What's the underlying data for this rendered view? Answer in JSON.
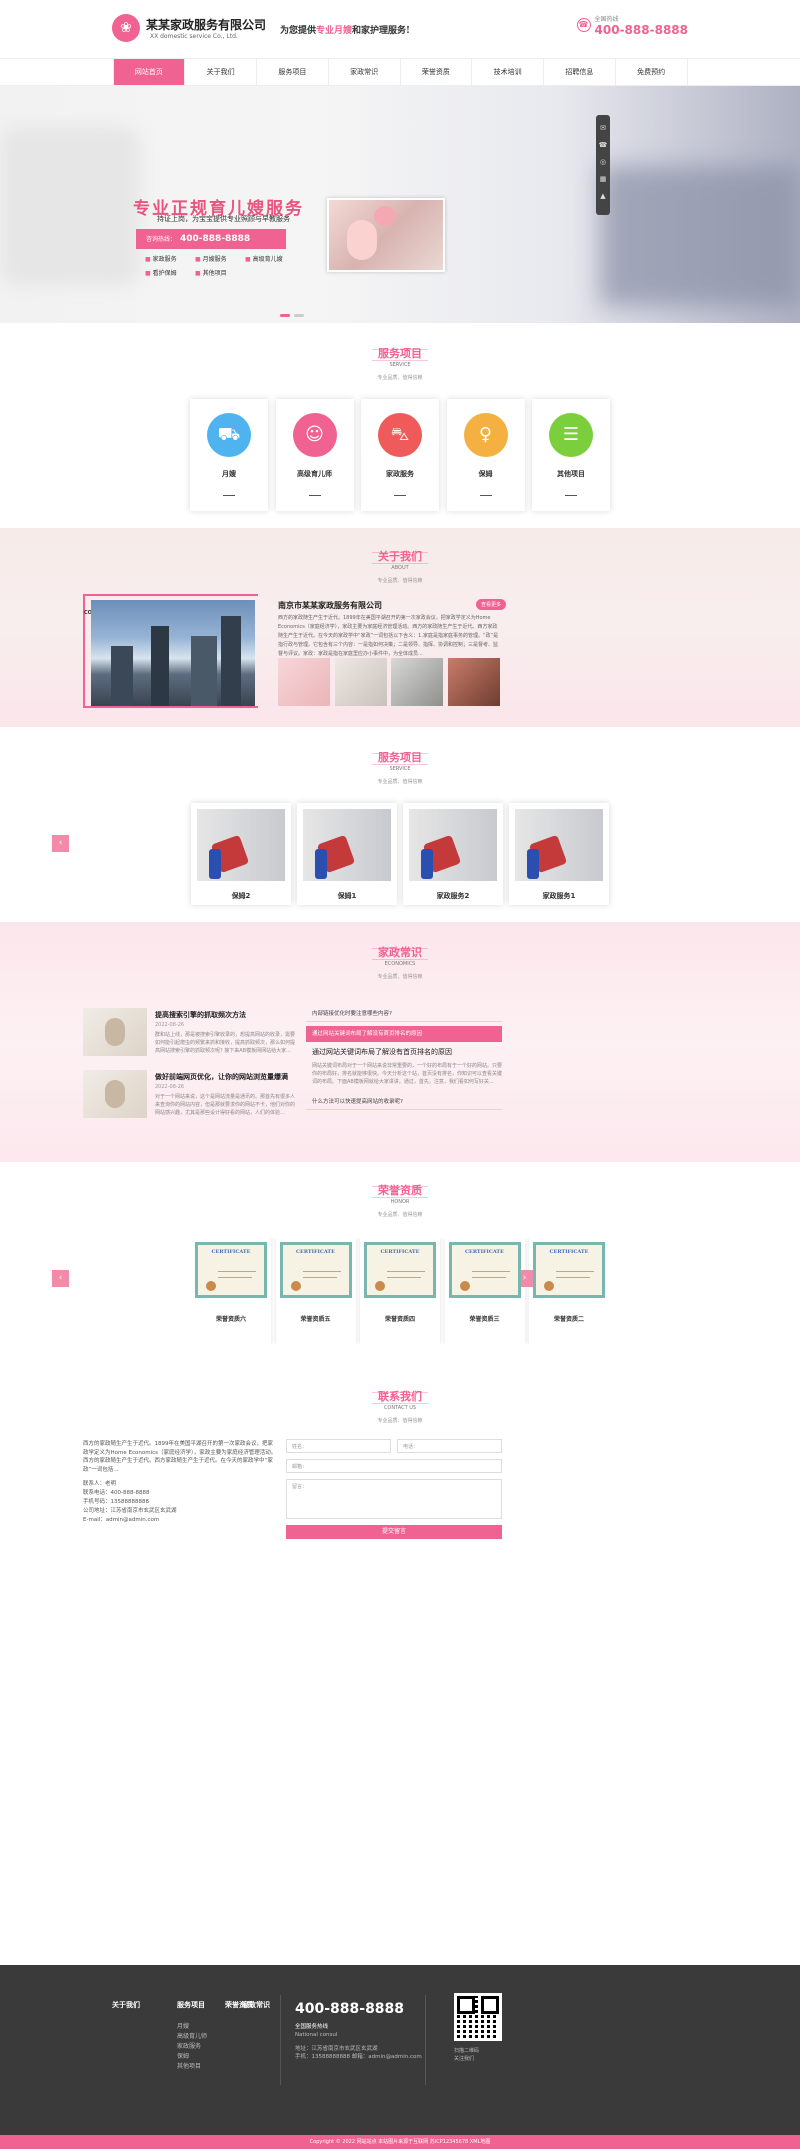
{
  "header": {
    "logo_icon": "flower-logo",
    "title": "某某家政服务有限公司",
    "subtitle": "XX domestic service Co., Ltd.",
    "slogan_pre": "为您提供",
    "slogan_hl": "专业月嫂",
    "slogan_post": "和家护理服务!",
    "hotline_label": "全国热线",
    "hotline": "400-888-8888"
  },
  "nav": [
    "网站首页",
    "关于我们",
    "服务项目",
    "家政常识",
    "荣誉资质",
    "技术培训",
    "招聘信息",
    "免费预约"
  ],
  "banner": {
    "title": "专业正规育儿嫂服务",
    "sub": "持证上岗，为宝宝提供专业照顾与早教服务",
    "phone_label": "咨询热线：",
    "phone": "400-888-8888",
    "tags": [
      "家政服务",
      "月嫂服务",
      "高级育儿嫂",
      "看护保姆",
      "其他项目"
    ]
  },
  "services": {
    "title": "服务项目",
    "en": "SERVICE",
    "desc": "专业品质、值得信赖",
    "items": [
      {
        "name": "月嫂",
        "icon": "stroller-icon",
        "color": "#4fb3f0"
      },
      {
        "name": "高级育儿师",
        "icon": "nurse-icon",
        "color": "#f06292"
      },
      {
        "name": "家政服务",
        "icon": "pram-icon",
        "color": "#ef5a5a"
      },
      {
        "name": "保姆",
        "icon": "woman-icon",
        "color": "#f5b042"
      },
      {
        "name": "其他项目",
        "icon": "clipboard-icon",
        "color": "#7ccf3c"
      }
    ]
  },
  "about": {
    "title": "关于我们",
    "en": "ABOUT",
    "desc": "专业品质、值得信赖",
    "vertical": "COMPANY",
    "company": "南京市某某家政服务有限公司",
    "more": "查看更多",
    "text": "西方的家政随生产生于近代。1899年在美国平湖召开的第一次家政会议，把家政学定义为Home Economics（家庭经济学），家政主要为家庭经济管理活动。西方的家政随生产生于近代。西方家政随生产生于近代。在今天的家政学中“家政”一词包括以下含义：1.家庭是指家庭事务的管理。“政”是指行政与管理。它包含有三个内容：一是指如何决策；二是领导、指挥、协调和控制；三是督考、监督与评议。家政：家政是指在家庭里应办小事件中，为全体成员..."
  },
  "items": {
    "title": "服务项目",
    "en": "SERVICE",
    "desc": "专业品质、值得信赖",
    "prev": "‹",
    "next": "›",
    "list": [
      "保姆2",
      "保姆1",
      "家政服务2",
      "家政服务1"
    ]
  },
  "know": {
    "title": "家政常识",
    "en": "ECONOMICS",
    "desc": "专业品质、值得信赖",
    "news": [
      {
        "title": "提高搜索引擎的抓取频次方法",
        "date": "2022-08-26",
        "summary": "群和站上线，那是被搜索引擎收录的，想提高网站的收录，需要如何能引起爬虫的频繁来抓和接收，提高抓取频次，那么如何提高网站搜索引擎的抓取频次呢? 接下来AB模板网网站给大家..."
      },
      {
        "title": "做好前端网页优化，让你的网站浏览量爆满",
        "date": "2022-08-26",
        "summary": "对于一个网站来说，这个是网站流量是通讯的。那首先有很多人来查询你的网站内容，但是那就要求你的网站不卡，他们对你的网站感兴趣，尤其是那些设计得好看的网站，人们的体验..."
      }
    ],
    "faq": [
      "内部链接优化时要注意哪些内容?",
      "通过网站关键词布局了解没有首页排名的原因",
      "什么方法可以快速提高网站的收录呢?"
    ],
    "faq_title": "通过网站关键词布局了解没有首页排名的原因",
    "faq_answer": "网站关键词布局对于一个网站来说非常重要的，一个好的布局有于一个好的网站。只要你的布局好，排名就能够很快。今天分析这个站，首页没有排名，你知识可以查看关键词的布局。下面AB模板网就给大家讲讲。通过，首先，注意，我们看如何写好关..."
  },
  "honor": {
    "title": "荣誉资质",
    "en": "HONOR",
    "desc": "专业品质、值得信赖",
    "prev": "‹",
    "next": "›",
    "cert_title": "CERTIFICATE",
    "list": [
      "荣誉资质六",
      "荣誉资质五",
      "荣誉资质四",
      "荣誉资质三",
      "荣誉资质二"
    ]
  },
  "contact": {
    "title": "联系我们",
    "en": "CONTACT US",
    "desc": "专业品质、值得信赖",
    "text": "西方的家政随生产生于近代。1899年在美国平湖召开的第一次家政会议，把家政学定义为Home Economics（家庭经济学），家政主要为家庭经济管理活动。西方的家政随生产生于近代。西方家政随生产生于近代。在今天的家政学中“家政”一词包括...",
    "info": [
      "联系人：老明",
      "联系电话：400-888-8888",
      "手机号码：13588888888",
      "公司地址：江苏省南京市玄武区玄武湖",
      "E-mail：admin@admin.com"
    ],
    "form": {
      "name": "姓名：",
      "phone": "电话：",
      "email": "邮箱：",
      "content": "留言：",
      "submit": "提交留言"
    }
  },
  "footer": {
    "cols": [
      {
        "title": "关于我们",
        "links": []
      },
      {
        "title": "服务项目",
        "links": [
          "月嫂",
          "高级育儿师",
          "家政服务",
          "保姆",
          "其他项目"
        ]
      },
      {
        "title": "家政常识",
        "links": []
      },
      {
        "title": "荣誉资质",
        "links": []
      }
    ],
    "phone": "400-888-8888",
    "phone_label": "全国服务热线",
    "phone_en": "National consul",
    "address": "地址：江苏省南京市玄武区玄武湖",
    "contact": "手机：13588888888 邮箱：admin@admin.com",
    "qr_caption_1": "扫描二维码",
    "qr_caption_2": "关注我们",
    "copyright": "Copyright © 2022 网站站点 本站图片来源于互联网 苏ICP12345678 XML地图"
  }
}
